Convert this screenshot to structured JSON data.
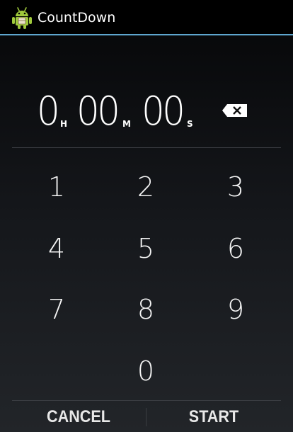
{
  "app": {
    "title": "CountDown",
    "icon": "android-robot-icon"
  },
  "colors": {
    "accent_line": "#5ea6cf",
    "app_icon_green": "#9fc93c"
  },
  "timer": {
    "hours": "0",
    "hours_unit": "H",
    "minutes": "00",
    "minutes_unit": "M",
    "seconds": "00",
    "seconds_unit": "S"
  },
  "keypad": {
    "k1": "1",
    "k2": "2",
    "k3": "3",
    "k4": "4",
    "k5": "5",
    "k6": "6",
    "k7": "7",
    "k8": "8",
    "k9": "9",
    "k0": "0"
  },
  "actions": {
    "cancel_label": "CANCEL",
    "start_label": "START"
  }
}
